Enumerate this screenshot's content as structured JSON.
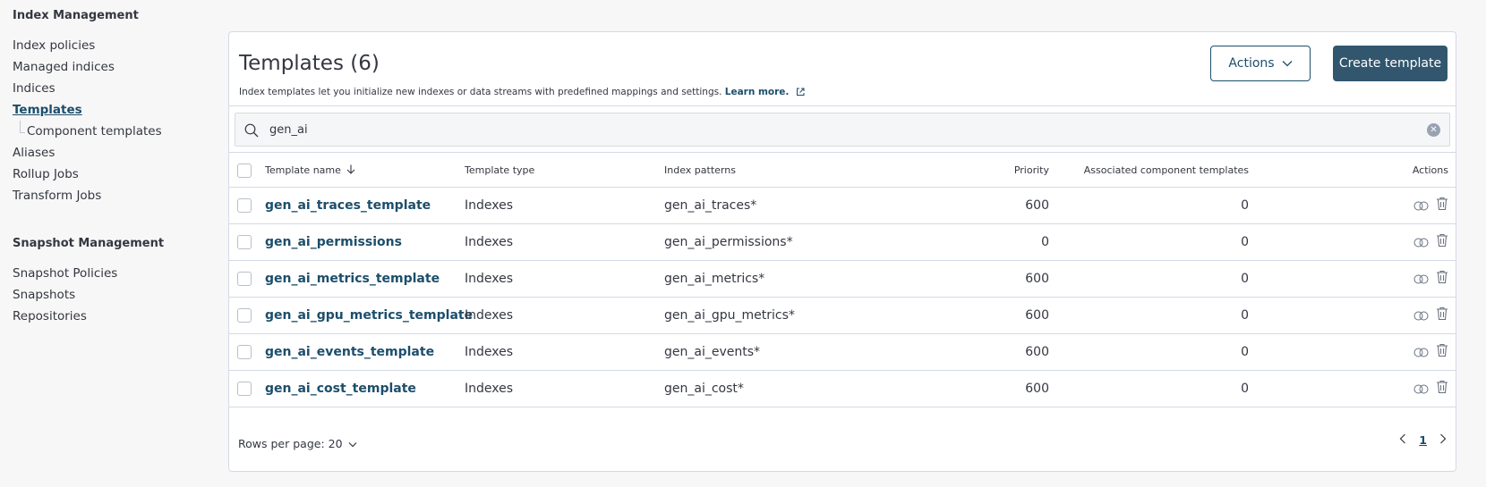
{
  "sidebar": {
    "index_heading": "Index Management",
    "index_items": [
      {
        "label": "Index policies"
      },
      {
        "label": "Managed indices"
      },
      {
        "label": "Indices"
      },
      {
        "label": "Templates"
      },
      {
        "label": "Component templates"
      },
      {
        "label": "Aliases"
      },
      {
        "label": "Rollup Jobs"
      },
      {
        "label": "Transform Jobs"
      }
    ],
    "snapshot_heading": "Snapshot Management",
    "snapshot_items": [
      {
        "label": "Snapshot Policies"
      },
      {
        "label": "Snapshots"
      },
      {
        "label": "Repositories"
      }
    ]
  },
  "panel": {
    "title": "Templates (6)",
    "description": "Index templates let you initialize new indexes or data streams with predefined mappings and settings.",
    "learn_more": "Learn more.",
    "actions_label": "Actions",
    "create_label": "Create template"
  },
  "search": {
    "value": "gen_ai"
  },
  "table": {
    "columns": {
      "name": "Template name",
      "type": "Template type",
      "patterns": "Index patterns",
      "priority": "Priority",
      "associated": "Associated component templates",
      "actions": "Actions"
    },
    "rows": [
      {
        "name": "gen_ai_traces_template",
        "type": "Indexes",
        "pattern": "gen_ai_traces*",
        "priority": "600",
        "associated": "0"
      },
      {
        "name": "gen_ai_permissions",
        "type": "Indexes",
        "pattern": "gen_ai_permissions*",
        "priority": "0",
        "associated": "0"
      },
      {
        "name": "gen_ai_metrics_template",
        "type": "Indexes",
        "pattern": "gen_ai_metrics*",
        "priority": "600",
        "associated": "0"
      },
      {
        "name": "gen_ai_gpu_metrics_template",
        "type": "Indexes",
        "pattern": "gen_ai_gpu_metrics*",
        "priority": "600",
        "associated": "0"
      },
      {
        "name": "gen_ai_events_template",
        "type": "Indexes",
        "pattern": "gen_ai_events*",
        "priority": "600",
        "associated": "0"
      },
      {
        "name": "gen_ai_cost_template",
        "type": "Indexes",
        "pattern": "gen_ai_cost*",
        "priority": "600",
        "associated": "0"
      }
    ]
  },
  "footer": {
    "rows_per_page": "Rows per page: 20",
    "current_page": "1"
  },
  "icons": [
    "search-icon",
    "clear-icon",
    "chevron-down-icon",
    "external-link-icon",
    "sort-arrow-down-icon",
    "compare-icon",
    "trash-icon",
    "chevron-left-icon",
    "chevron-right-icon"
  ],
  "colors": {
    "primary": "#31566e",
    "link": "#1c4e6b",
    "border": "#d3dae6",
    "background": "#f7f7f7"
  }
}
